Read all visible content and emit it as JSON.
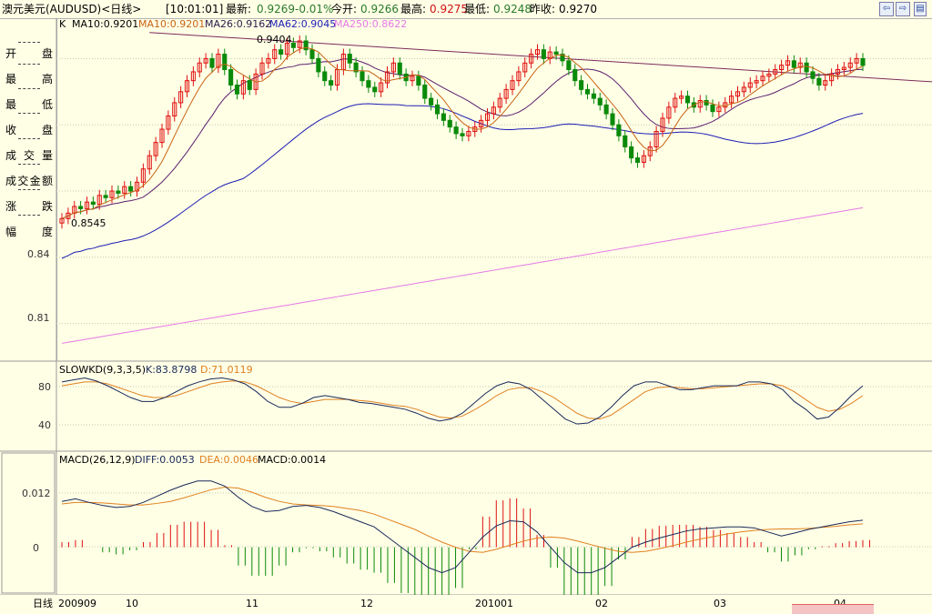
{
  "header": {
    "symbol": "澳元美元(AUDUSD)<日线>",
    "time": "[10:01:01]",
    "latest_label": "最新:",
    "latest": "0.9269",
    "change": "-0.01%",
    "open_label": "今开:",
    "open": "0.9266",
    "high_label": "最高:",
    "high": "0.9275",
    "low_label": "最低:",
    "low": "0.9248",
    "prev_label": "昨收:",
    "prev_close": "0.9270"
  },
  "nav": {
    "back": "⇦",
    "forward": "⇨"
  },
  "left_panel": {
    "fields": [
      "开盘",
      "最高",
      "最低",
      "收盘",
      "成交量",
      "成交金额",
      "涨跌",
      "幅度"
    ],
    "values": [
      "------",
      "------",
      "------",
      "------",
      "------",
      "------",
      "------",
      "------"
    ]
  },
  "main_panel": {
    "indicator_line": {
      "k": "K",
      "ma10a": "MA10:0.9201",
      "ma10b": "MA10:0.9201",
      "ma26": "MA26:0.9162",
      "ma62": "MA62:0.9045",
      "ma250": "MA250:0.8622"
    },
    "y_ticks": [
      "0.84",
      "0.81"
    ],
    "max_label": "0.9404",
    "min_label": "0.8545"
  },
  "kd_panel": {
    "title": "SLOWKD(9,3,3,5)",
    "k_label": "K:83.8798",
    "d_label": "D:71.0119",
    "y_ticks": [
      "80",
      "40"
    ]
  },
  "macd_panel": {
    "title": "MACD(26,12,9)",
    "diff_label": "DIFF:0.0053",
    "dea_label": "DEA:0.0046",
    "macd_label": "MACD:0.0014",
    "y_ticks": [
      "0.012",
      "0"
    ]
  },
  "x_axis": {
    "period_label": "日线",
    "ticks": [
      "200909",
      "10",
      "11",
      "12",
      "201001",
      "02",
      "03",
      "04"
    ]
  },
  "colors": {
    "bg": "#ffffe6",
    "up": "#e01010",
    "down": "#0a8a0a",
    "ma10": "#c86414",
    "ma26": "#5a1e6e",
    "ma62": "#1e1eb4",
    "ma250": "#e678e6",
    "trendline": "#7a2a5a",
    "kd_k": "#1a2a5a",
    "kd_d": "#e08020",
    "macd_diff": "#1a2a5a",
    "macd_dea": "#e08020"
  },
  "chart_data": {
    "type": "candlestick",
    "series_close": [
      0.8575,
      0.86,
      0.863,
      0.862,
      0.865,
      0.864,
      0.868,
      0.867,
      0.87,
      0.869,
      0.872,
      0.87,
      0.874,
      0.88,
      0.886,
      0.892,
      0.898,
      0.904,
      0.91,
      0.915,
      0.92,
      0.924,
      0.928,
      0.93,
      0.926,
      0.932,
      0.925,
      0.918,
      0.914,
      0.92,
      0.916,
      0.923,
      0.928,
      0.93,
      0.934,
      0.932,
      0.937,
      0.935,
      0.938,
      0.934,
      0.93,
      0.924,
      0.92,
      0.918,
      0.925,
      0.932,
      0.928,
      0.924,
      0.92,
      0.917,
      0.915,
      0.919,
      0.924,
      0.928,
      0.923,
      0.92,
      0.922,
      0.918,
      0.912,
      0.909,
      0.905,
      0.902,
      0.899,
      0.896,
      0.895,
      0.897,
      0.899,
      0.902,
      0.905,
      0.908,
      0.912,
      0.916,
      0.92,
      0.924,
      0.928,
      0.932,
      0.934,
      0.93,
      0.933,
      0.932,
      0.929,
      0.925,
      0.92,
      0.916,
      0.914,
      0.912,
      0.909,
      0.905,
      0.9,
      0.895,
      0.89,
      0.885,
      0.883,
      0.886,
      0.89,
      0.897,
      0.903,
      0.908,
      0.912,
      0.913,
      0.91,
      0.908,
      0.911,
      0.909,
      0.906,
      0.908,
      0.91,
      0.913,
      0.915,
      0.917,
      0.919,
      0.92,
      0.922,
      0.923,
      0.925,
      0.927,
      0.929,
      0.926,
      0.928,
      0.924,
      0.921,
      0.918,
      0.92,
      0.923,
      0.925,
      0.926,
      0.928,
      0.93,
      0.9269
    ],
    "series_kd_k": [
      84,
      86,
      88,
      85,
      80,
      74,
      68,
      64,
      64,
      68,
      74,
      80,
      84,
      87,
      88,
      86,
      82,
      74,
      64,
      58,
      58,
      62,
      68,
      70,
      68,
      66,
      63,
      62,
      60,
      58,
      56,
      52,
      47,
      44,
      46,
      52,
      62,
      72,
      80,
      84,
      82,
      76,
      66,
      56,
      46,
      41,
      42,
      48,
      58,
      70,
      80,
      84,
      84,
      80,
      76,
      76,
      78,
      80,
      80,
      80,
      84,
      84,
      82,
      76,
      64,
      56,
      46,
      48,
      58,
      70,
      80
    ],
    "series_kd_d": [
      80,
      82,
      84,
      84,
      82,
      78,
      74,
      70,
      68,
      68,
      70,
      74,
      78,
      82,
      84,
      85,
      84,
      80,
      74,
      68,
      64,
      62,
      64,
      66,
      66,
      66,
      65,
      64,
      62,
      60,
      59,
      56,
      52,
      48,
      47,
      49,
      55,
      62,
      70,
      76,
      78,
      78,
      74,
      68,
      60,
      52,
      47,
      46,
      50,
      58,
      66,
      74,
      78,
      79,
      78,
      77,
      77,
      78,
      79,
      80,
      81,
      82,
      82,
      80,
      74,
      66,
      58,
      54,
      56,
      62,
      70
    ],
    "series_macd_diff": [
      0.009,
      0.0095,
      0.0088,
      0.0082,
      0.0078,
      0.008,
      0.0088,
      0.01,
      0.0112,
      0.0122,
      0.013,
      0.013,
      0.012,
      0.0098,
      0.008,
      0.007,
      0.0072,
      0.008,
      0.0082,
      0.0078,
      0.007,
      0.006,
      0.005,
      0.004,
      0.002,
      0.0,
      -0.002,
      -0.004,
      -0.005,
      -0.004,
      -0.001,
      0.002,
      0.0042,
      0.0052,
      0.005,
      0.003,
      0.0,
      -0.003,
      -0.005,
      -0.005,
      -0.004,
      -0.002,
      0.0,
      0.001,
      0.0018,
      0.0025,
      0.0032,
      0.0036,
      0.0038,
      0.004,
      0.004,
      0.0038,
      0.003,
      0.0022,
      0.0028,
      0.0035,
      0.004,
      0.0045,
      0.005,
      0.0053
    ],
    "series_macd_dea": [
      0.0085,
      0.0088,
      0.0088,
      0.0087,
      0.0085,
      0.0083,
      0.0083,
      0.0086,
      0.009,
      0.0097,
      0.0105,
      0.0113,
      0.0118,
      0.0116,
      0.0108,
      0.0098,
      0.009,
      0.0085,
      0.0083,
      0.0082,
      0.008,
      0.0076,
      0.0072,
      0.0065,
      0.0055,
      0.0045,
      0.0035,
      0.0022,
      0.001,
      0.0,
      -0.0008,
      -0.001,
      -0.0004,
      0.0004,
      0.0012,
      0.0018,
      0.002,
      0.0018,
      0.0012,
      0.0005,
      -0.0002,
      -0.0008,
      -0.001,
      -0.0008,
      -0.0003,
      0.0003,
      0.001,
      0.0016,
      0.0021,
      0.0026,
      0.003,
      0.0033,
      0.0035,
      0.0036,
      0.0036,
      0.0037,
      0.0039,
      0.0041,
      0.0044,
      0.0046
    ],
    "y_range_main": [
      0.795,
      0.945
    ],
    "y_range_kd": [
      15,
      95
    ],
    "y_range_macd": [
      -0.009,
      0.016
    ]
  }
}
